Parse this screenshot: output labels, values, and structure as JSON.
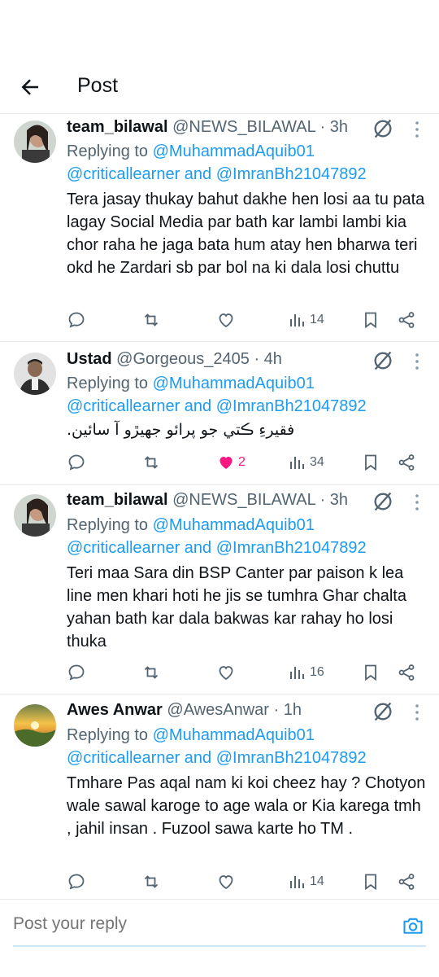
{
  "header": {
    "title": "Post"
  },
  "tweets": [
    {
      "name": "team_bilawal",
      "meta": "@NEWS_BILAWAL · 3h",
      "replying_prefix": "Replying to",
      "mention1": "@MuhammadAquib01",
      "mention2": "@criticallearner",
      "and": "and",
      "mention3": "@ImranBh21047892",
      "text": "Tera jasay thukay bahut dakhe hen losi aa tu pata lagay Social Media par bath kar lambi lambi kia chor raha he jaga bata hum atay hen bharwa teri okd he Zardari sb par bol na ki dala losi chuttu",
      "likes": "",
      "views": "14",
      "liked": false
    },
    {
      "name": "Ustad",
      "meta": "@Gorgeous_2405 · 4h",
      "replying_prefix": "Replying to",
      "mention1": "@MuhammadAquib01",
      "mention2": "@criticallearner",
      "and": "and",
      "mention3": "@ImranBh21047892",
      "text": "فقيرءِ ڪتي جو پرائو جهيڙو آ سائين.",
      "likes": "2",
      "views": "34",
      "liked": true
    },
    {
      "name": "team_bilawal",
      "meta": "@NEWS_BILAWAL · 3h",
      "replying_prefix": "Replying to",
      "mention1": "@MuhammadAquib01",
      "mention2": "@criticallearner",
      "and": "and",
      "mention3": "@ImranBh21047892",
      "text": "Teri maa Sara din BSP Canter par paison k lea line men khari hoti he jis se tumhra Ghar chalta yahan bath kar dala bakwas kar rahay ho losi thuka",
      "likes": "",
      "views": "16",
      "liked": false
    },
    {
      "name": "Awes Anwar",
      "meta": "@AwesAnwar · 1h",
      "replying_prefix": "Replying to",
      "mention1": "@MuhammadAquib01",
      "mention2": "@criticallearner",
      "and": "and",
      "mention3": "@ImranBh21047892",
      "text": "Tmhare Pas aqal nam ki koi cheez hay ? Chotyon wale sawal karoge to age wala or Kia karega tmh , jahil insan . Fuzool sawa karte ho TM .",
      "likes": "",
      "views": "14",
      "liked": false
    }
  ],
  "reply_bar": {
    "placeholder": "Post your reply"
  },
  "colors": {
    "accent": "#1d9bf0",
    "like": "#f91880",
    "secondary_text": "#536471"
  }
}
